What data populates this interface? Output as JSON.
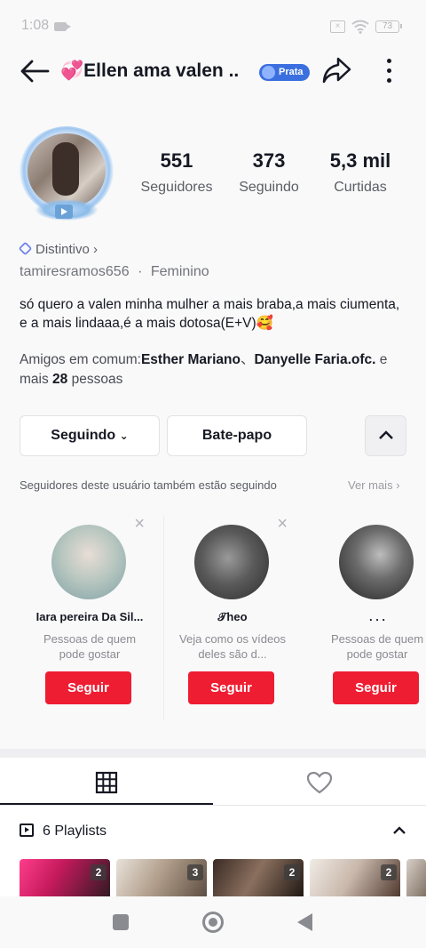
{
  "status_bar": {
    "time": "1:08",
    "battery": "73"
  },
  "header": {
    "title": "💞Ellen ama valen ..",
    "badge": "Prata"
  },
  "stats": [
    {
      "value": "551",
      "label": "Seguidores"
    },
    {
      "value": "373",
      "label": "Seguindo"
    },
    {
      "value": "5,3 mil",
      "label": "Curtidas"
    }
  ],
  "profile": {
    "distintivo": "Distintivo ›",
    "username": "tamiresramos656",
    "separator": "·",
    "gender": "Feminino",
    "bio": "só quero a valen minha mulher a mais braba,a mais ciumenta, e a mais lindaaa,é a mais dotosa(E+V)🥰",
    "friends_prefix": "Amigos em comum:",
    "friend_1": "Esther Mariano",
    "friend_sep": "、",
    "friend_2": "Danyelle Faria.ofc.",
    "friends_mid": " e mais ",
    "friends_count": "28",
    "friends_suffix": " pessoas"
  },
  "actions": {
    "following_label": "Seguindo",
    "chat_label": "Bate-papo"
  },
  "suggestions": {
    "title": "Seguidores deste usuário também estão seguindo",
    "see_more": "Ver mais",
    "cards": [
      {
        "name": "Iara pereira Da Sil...",
        "desc": "Pessoas de quem pode gostar",
        "button": "Seguir"
      },
      {
        "name": "𝒯heo",
        "desc": "Veja como os vídeos deles são d...",
        "button": "Seguir"
      },
      {
        "name": ". . .",
        "desc": "Pessoas de quem pode gostar",
        "button": "Seguir"
      }
    ]
  },
  "playlists": {
    "label": "6 Playlists",
    "counts": [
      "2",
      "3",
      "2",
      "2"
    ]
  },
  "colors": {
    "accent_red": "#ee1d32",
    "badge_blue": "#3b6fe0",
    "text_primary": "#161823"
  }
}
